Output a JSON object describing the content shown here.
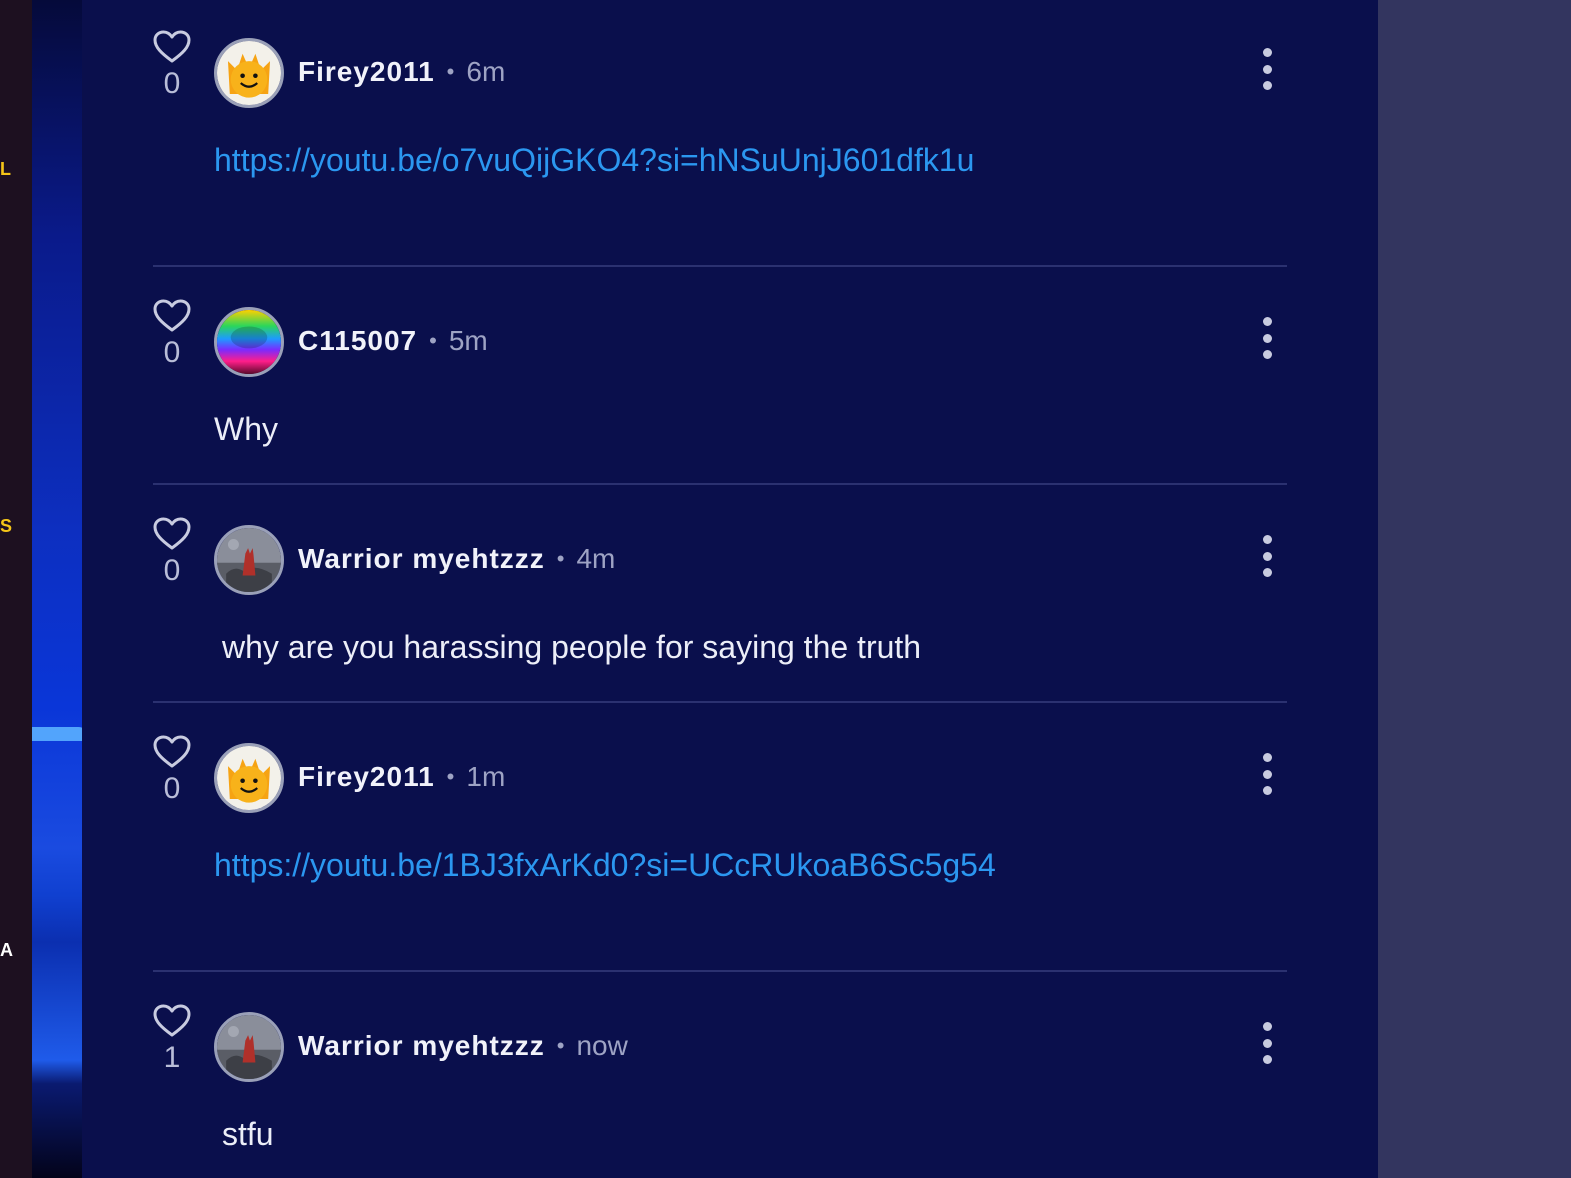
{
  "background_edge": {
    "letters": [
      "L",
      "S",
      "A"
    ]
  },
  "comments": [
    {
      "likes": "0",
      "username": "Firey2011",
      "separator": "•",
      "time": "6m",
      "text": "https://youtu.be/o7vuQijGKO4?si=hNSuUnjJ601dfk1u",
      "is_link": true,
      "avatar": "firey-avatar"
    },
    {
      "likes": "0",
      "username": "C115007",
      "separator": "•",
      "time": "5m",
      "text": "Why",
      "is_link": false,
      "avatar": "rainbow-avatar"
    },
    {
      "likes": "0",
      "username": "Warrior myehtzzz",
      "separator": "•",
      "time": "4m",
      "text": "why are you harassing people for saying the truth",
      "is_link": false,
      "avatar": "warrior-avatar"
    },
    {
      "likes": "0",
      "username": "Firey2011",
      "separator": "•",
      "time": "1m",
      "text": "https://youtu.be/1BJ3fxArKd0?si=UCcRUkoaB6Sc5g54",
      "is_link": true,
      "avatar": "firey-avatar"
    },
    {
      "likes": "1",
      "username": "Warrior myehtzzz",
      "separator": "•",
      "time": "now",
      "text": "stfu",
      "is_link": false,
      "avatar": "warrior-avatar"
    }
  ],
  "colors": {
    "background": "#0a0f4c",
    "link": "#2b97f0",
    "right_panel": "#33355f"
  }
}
